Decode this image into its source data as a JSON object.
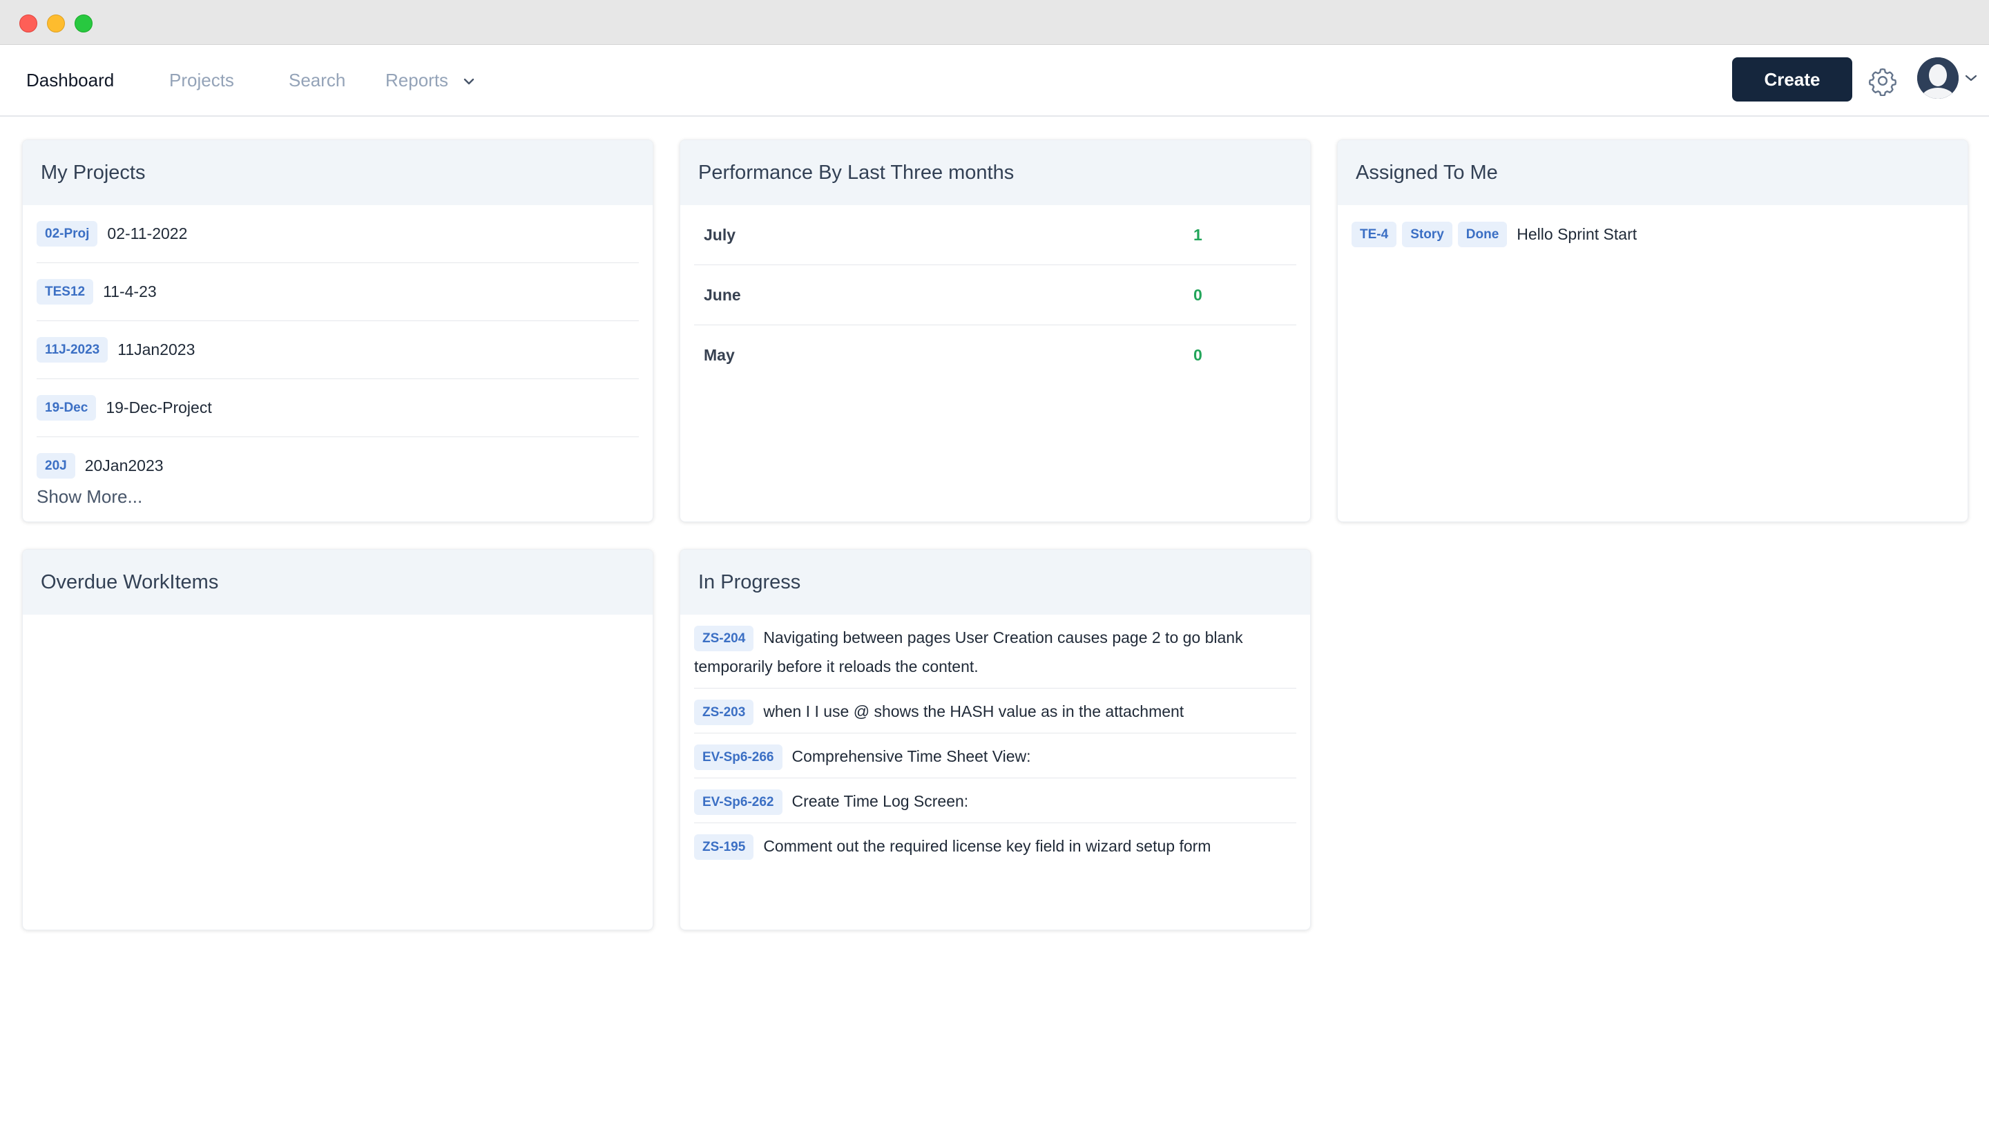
{
  "nav": {
    "dashboard": "Dashboard",
    "projects": "Projects",
    "search": "Search",
    "reports": "Reports",
    "create": "Create"
  },
  "my_projects": {
    "title": "My Projects",
    "items": [
      {
        "key": "02-Proj",
        "name": "02-11-2022"
      },
      {
        "key": "TES12",
        "name": "11-4-23"
      },
      {
        "key": "11J-2023",
        "name": "11Jan2023"
      },
      {
        "key": "19-Dec",
        "name": "19-Dec-Project"
      },
      {
        "key": "20J",
        "name": "20Jan2023"
      }
    ],
    "show_more": "Show More..."
  },
  "performance": {
    "title": "Performance By Last Three months",
    "rows": [
      {
        "month": "July",
        "value": "1"
      },
      {
        "month": "June",
        "value": "0"
      },
      {
        "month": "May",
        "value": "0"
      }
    ]
  },
  "assigned": {
    "title": "Assigned To Me",
    "items": [
      {
        "key": "TE-4",
        "type": "Story",
        "status": "Done",
        "title": "Hello Sprint Start"
      }
    ]
  },
  "overdue": {
    "title": "Overdue WorkItems"
  },
  "in_progress": {
    "title": "In Progress",
    "items": [
      {
        "key": "ZS-204",
        "title": "Navigating between pages User Creation causes page 2 to go blank temporarily before it reloads the content."
      },
      {
        "key": "ZS-203",
        "title": "when I I use @ shows the HASH value as in the attachment"
      },
      {
        "key": "EV-Sp6-266",
        "title": "Comprehensive Time Sheet View:"
      },
      {
        "key": "EV-Sp6-262",
        "title": "Create Time Log Screen:"
      },
      {
        "key": "ZS-195",
        "title": "Comment out the required license key field in wizard setup form"
      }
    ]
  },
  "colors": {
    "primary_button": "#15263d",
    "tag_bg": "#e8f0fb",
    "tag_text": "#3b6fc4",
    "positive_value": "#22a55a",
    "card_header_bg": "#f1f5f9"
  }
}
